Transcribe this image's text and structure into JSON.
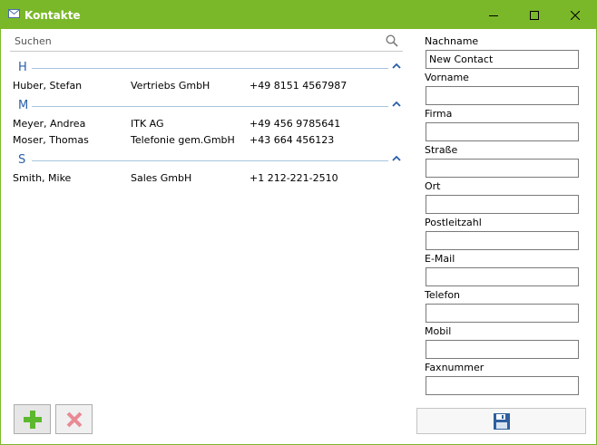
{
  "window": {
    "title": "Kontakte",
    "icon": "envelope-icon",
    "controls": [
      "minimize-icon",
      "maximize-icon",
      "close-icon"
    ],
    "accent_color": "#7ab82a"
  },
  "search": {
    "placeholder": "Suchen",
    "value": ""
  },
  "groups": [
    {
      "letter": "H",
      "contacts": [
        {
          "name": "Huber, Stefan",
          "company": "Vertriebs GmbH",
          "phone": "+49 8151 4567987"
        }
      ]
    },
    {
      "letter": "M",
      "contacts": [
        {
          "name": "Meyer, Andrea",
          "company": "ITK AG",
          "phone": "+49 456 9785641"
        },
        {
          "name": "Moser, Thomas",
          "company": "Telefonie gem.GmbH",
          "phone": "+43 664 456123"
        }
      ]
    },
    {
      "letter": "S",
      "contacts": [
        {
          "name": "Smith, Mike",
          "company": "Sales GmbH",
          "phone": "+1 212-221-2510"
        }
      ]
    }
  ],
  "form": {
    "fields": [
      {
        "label": "Nachname",
        "value": "New Contact"
      },
      {
        "label": "Vorname",
        "value": ""
      },
      {
        "label": "Firma",
        "value": ""
      },
      {
        "label": "Straße",
        "value": ""
      },
      {
        "label": "Ort",
        "value": ""
      },
      {
        "label": "Postleitzahl",
        "value": ""
      },
      {
        "label": "E-Mail",
        "value": ""
      },
      {
        "label": "Telefon",
        "value": ""
      },
      {
        "label": "Mobil",
        "value": ""
      },
      {
        "label": "Faxnummer",
        "value": ""
      }
    ]
  },
  "buttons": {
    "add": "plus-icon",
    "delete": "x-icon",
    "save": "save-icon"
  }
}
